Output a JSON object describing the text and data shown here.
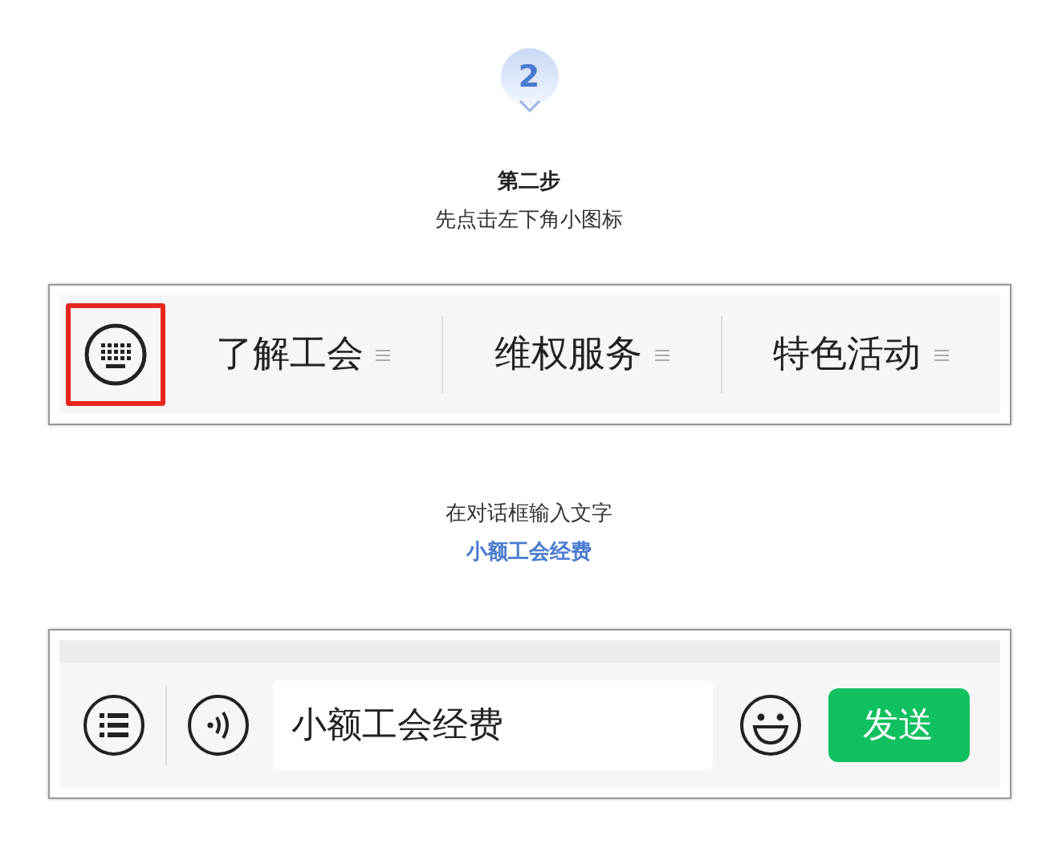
{
  "step": {
    "number": "2",
    "title": "第二步",
    "instruction": "先点击左下角小图标"
  },
  "menu_bar": {
    "keyboard_highlighted": true,
    "items": [
      {
        "label": "了解工会"
      },
      {
        "label": "维权服务"
      },
      {
        "label": "特色活动"
      }
    ]
  },
  "instruction_2": {
    "text": "在对话框输入文字",
    "highlight": "小额工会经费"
  },
  "input_bar": {
    "value": "小额工会经费",
    "send_label": "发送"
  }
}
